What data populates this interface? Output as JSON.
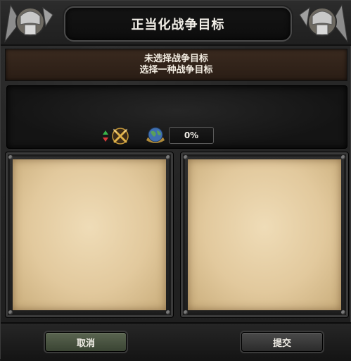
{
  "window": {
    "title": "正当化战争目标"
  },
  "banner": {
    "line1": "未选择战争目标",
    "line2": "选择一种战争目标"
  },
  "info": {
    "progress_percent": "0%"
  },
  "footer": {
    "cancel_label": "取消",
    "submit_label": "提交"
  },
  "colors": {
    "banner_bg": "#3a2a1f",
    "parchment": "#e2c99d",
    "cancel_button": "#4b5642",
    "submit_button": "#3a3a3a"
  },
  "icons": [
    "helmet-emblem-icon",
    "up-down-arrows-icon",
    "crossed-swords-icon",
    "globe-icon"
  ]
}
